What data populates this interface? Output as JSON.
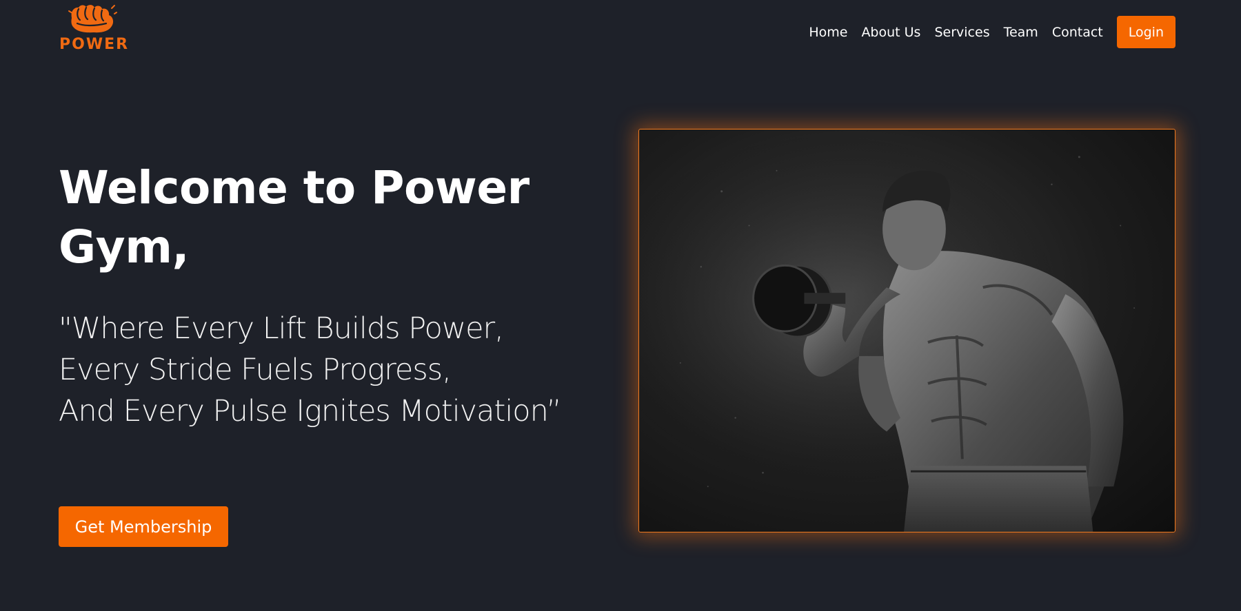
{
  "brand": {
    "name": "POWER",
    "logo_icon": "fist-icon",
    "accent_color": "#f56700",
    "background_color": "#1e2129"
  },
  "nav": {
    "links": [
      "Home",
      "About Us",
      "Services",
      "Team",
      "Contact"
    ],
    "login_label": "Login"
  },
  "hero": {
    "title": "Welcome to Power Gym,",
    "quote_lines": [
      "\"Where Every Lift Builds Power,",
      "Every Stride Fuels Progress,",
      "And Every Pulse Ignites Motivation”"
    ],
    "cta_label": "Get Membership",
    "image_subject": "bodybuilder-dumbbell-photo"
  }
}
